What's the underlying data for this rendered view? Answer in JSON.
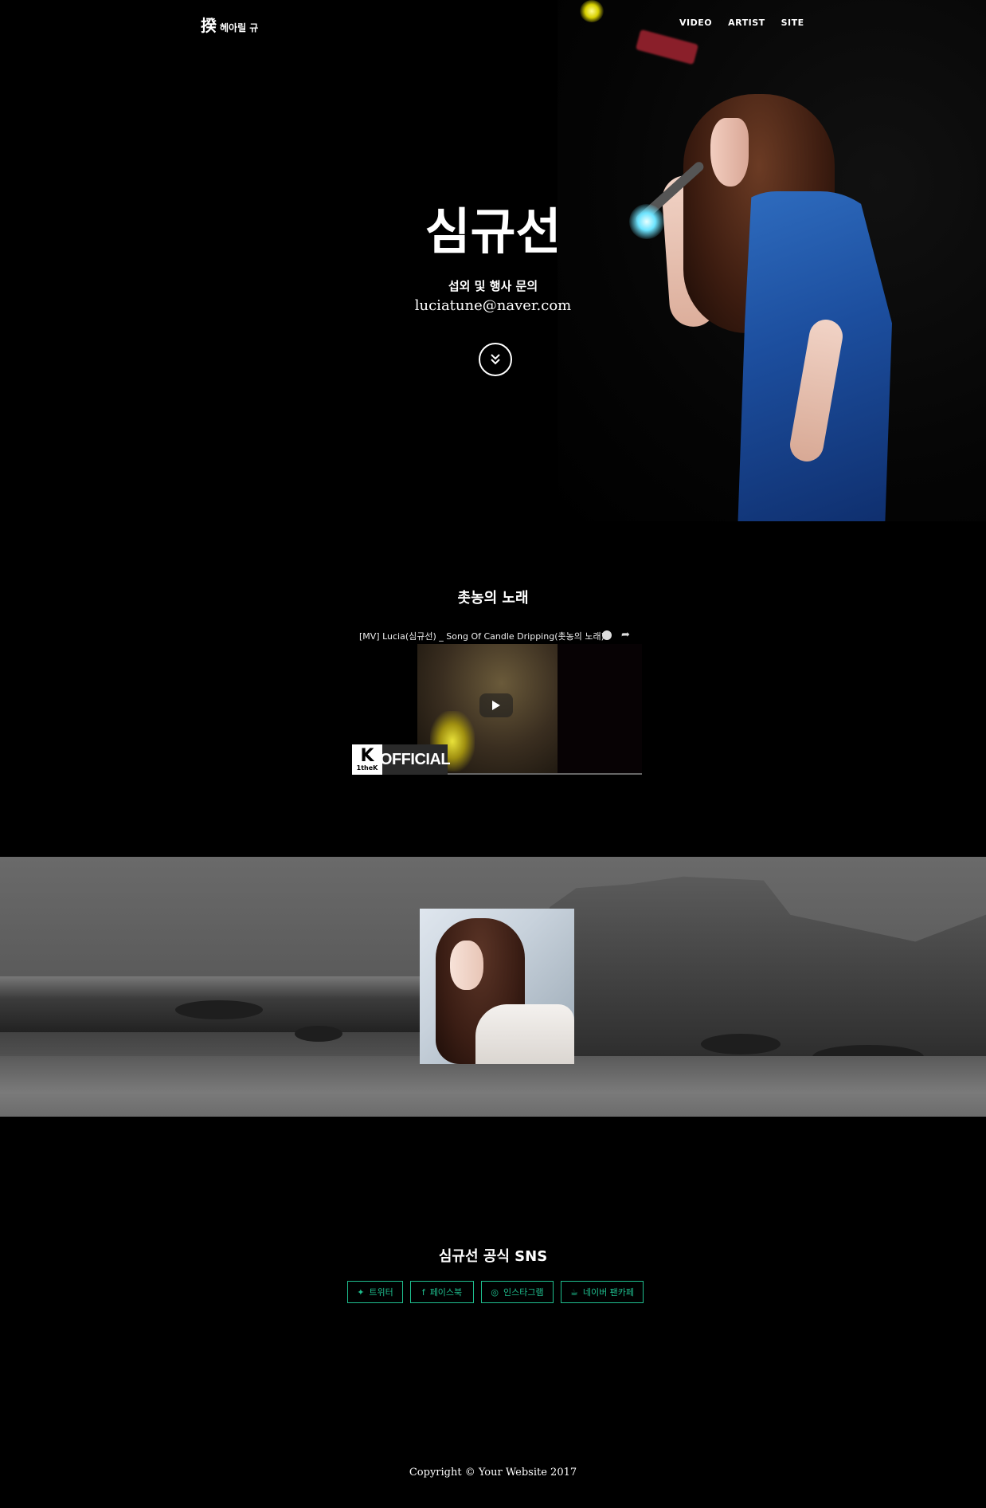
{
  "nav": {
    "brand_glyph": "揆",
    "brand_text": "헤아릴 규",
    "menu": [
      {
        "label": "VIDEO"
      },
      {
        "label": "ARTIST"
      },
      {
        "label": "SITE"
      }
    ]
  },
  "hero": {
    "title": "심규선",
    "subtitle": "섭외 및 행사 문의",
    "email": "luciatune@naver.com",
    "scroll_icon": "double-chevron-down-icon"
  },
  "video": {
    "section_title": "촛농의 노래",
    "player_title": "[MV] Lucia(심규선) _ Song Of Candle Dripping(촛농의 노래)",
    "channel_logo_k": "K",
    "channel_logo_sub": "1theK",
    "channel_badge": "OFFICIAL"
  },
  "sns": {
    "title": "심규선 공식 SNS",
    "buttons": [
      {
        "label": "트위터",
        "icon": "twitter-icon",
        "glyph": "✦"
      },
      {
        "label": "페이스북",
        "icon": "facebook-icon",
        "glyph": "f"
      },
      {
        "label": "인스타그램",
        "icon": "instagram-icon",
        "glyph": "◎"
      },
      {
        "label": "네이버 팬카페",
        "icon": "coffee-icon",
        "glyph": "☕"
      }
    ],
    "accent_color": "#1fbf8f"
  },
  "footer": {
    "copyright": "Copyright © Your Website 2017"
  }
}
